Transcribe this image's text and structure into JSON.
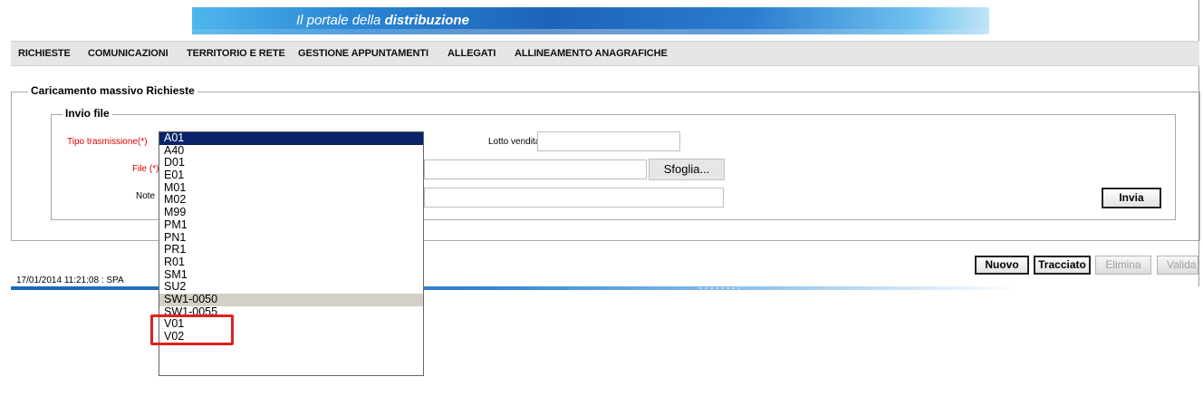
{
  "header": {
    "title_prefix": "Il portale della",
    "title_bold": "distribuzione"
  },
  "menu": {
    "items": [
      {
        "label": "RICHIESTE"
      },
      {
        "label": "COMUNICAZIONI"
      },
      {
        "label": "TERRITORIO E RETE"
      },
      {
        "label": "GESTIONE APPUNTAMENTI"
      },
      {
        "label": "ALLEGATI"
      },
      {
        "label": "ALLINEAMENTO ANAGRAFICHE"
      }
    ]
  },
  "upload_form": {
    "legend": "Caricamento massivo Richieste",
    "file_section": {
      "legend": "Invio file",
      "tipo_label": "Tipo trasmissione(*)",
      "tipo_selected": "A01",
      "file_label": "File (*)",
      "note_label": "Note",
      "lotto_label": "Lotto vendita",
      "lotto_value": "",
      "browse_label": "Sfoglia...",
      "send_label": "Invia"
    }
  },
  "actions": {
    "nuovo": "Nuovo",
    "tracciato": "Tracciato",
    "elimina": "Elimina",
    "valida": "Valida"
  },
  "status": {
    "text": "17/01/2014 11:21:08  :  SPA"
  },
  "dropdown": {
    "options": [
      "A01",
      "A40",
      "D01",
      "E01",
      "M01",
      "M02",
      "M99",
      "PM1",
      "PN1",
      "PR1",
      "R01",
      "SM1",
      "SU2",
      "SW1-0050",
      "SW1-0055",
      "V01",
      "V02"
    ],
    "selected": "A01",
    "hovered": "SW1-0050",
    "highlighted": [
      "SW1-0050",
      "SW1-0055"
    ]
  },
  "colors": {
    "required_label": "#e00000",
    "selected_option_bg": "#0a246a",
    "highlight_box": "#e02020",
    "menu_bg": "#e6e6e6"
  }
}
